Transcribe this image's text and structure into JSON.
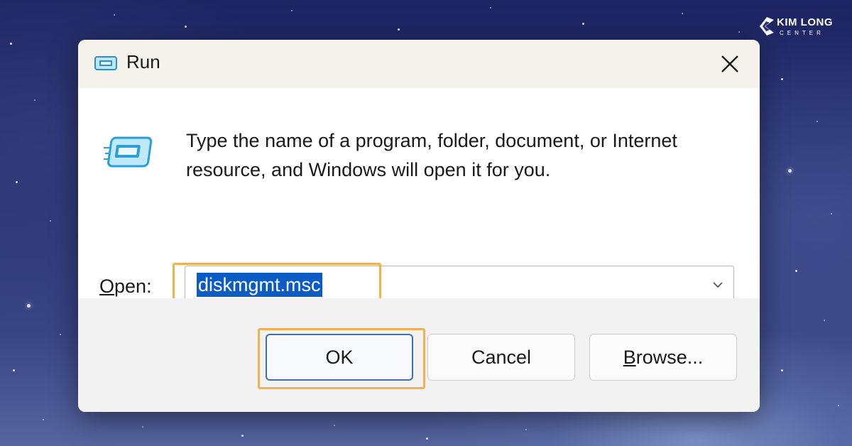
{
  "brand": {
    "name_line1": "KIM LONG",
    "name_line2": "CENTER"
  },
  "dialog": {
    "title": "Run",
    "close_icon": "close-icon",
    "app_icon": "run-icon",
    "description": "Type the name of a program, folder, document, or Internet resource, and Windows will open it for you.",
    "open_label": "Open:",
    "open_label_accesskey": "O",
    "open_label_rest": "pen:",
    "open_value": "diskmgmt.msc",
    "dropdown_icon": "chevron-down-icon"
  },
  "buttons": {
    "ok_label": "OK",
    "cancel_label": "Cancel",
    "browse_label": "Browse...",
    "browse_accesskey": "B",
    "browse_rest": "rowse..."
  },
  "colors": {
    "highlight": "#f0b24c",
    "selection": "#0a5bc4",
    "focus": "#3a6fb8"
  }
}
